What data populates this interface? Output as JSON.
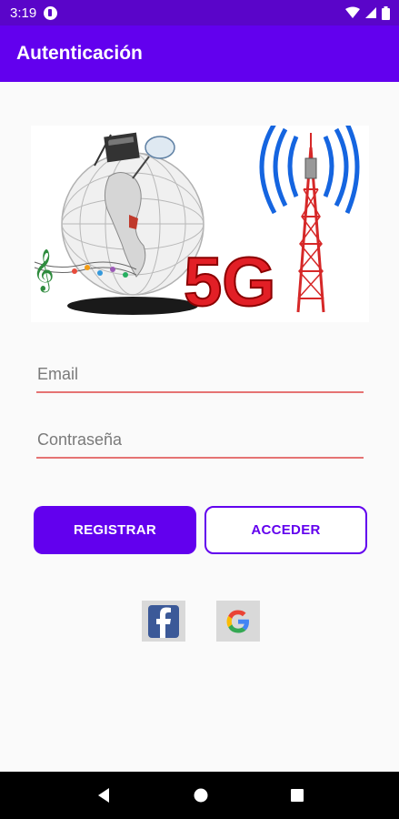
{
  "status_bar": {
    "time": "3:19",
    "icons": [
      "app-notification-icon",
      "wifi-icon",
      "signal-icon",
      "battery-icon"
    ]
  },
  "app_bar": {
    "title": "Autenticación"
  },
  "banner": {
    "text_5g": "5G",
    "icons": [
      "globe-icon",
      "satellite-dish-icon",
      "music-notes-icon",
      "cell-tower-icon"
    ]
  },
  "form": {
    "email_placeholder": "Email",
    "email_value": "",
    "password_placeholder": "Contraseña",
    "password_value": ""
  },
  "buttons": {
    "register_label": "REGISTRAR",
    "login_label": "ACCEDER"
  },
  "social": {
    "icons": [
      "facebook-icon",
      "google-icon"
    ]
  },
  "nav_bar": {
    "icons": [
      "back-icon",
      "home-icon",
      "recents-icon"
    ]
  },
  "colors": {
    "primary": "#6200ee",
    "primary_dark": "#5a05c9",
    "field_underline": "#e57373",
    "background": "#fafafa"
  }
}
